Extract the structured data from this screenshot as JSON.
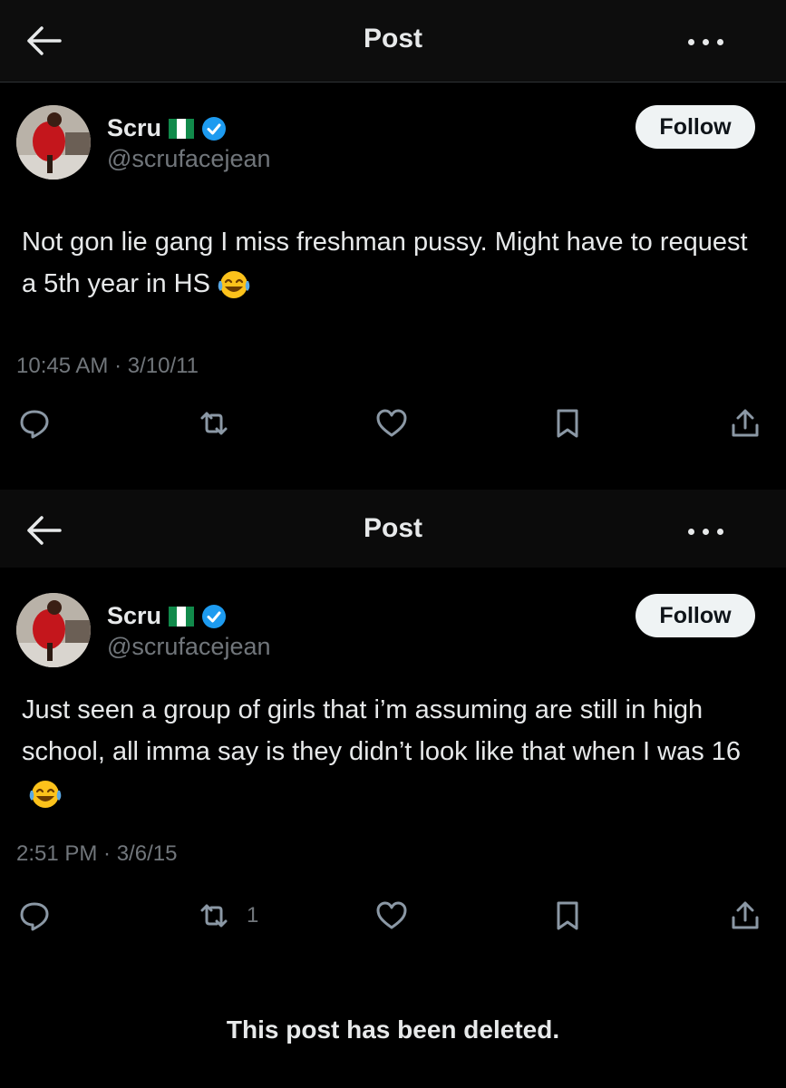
{
  "header": {
    "title": "Post"
  },
  "posts": [
    {
      "name": "Scru",
      "handle": "@scrufacejean",
      "follow_label": "Follow",
      "text": "Not gon lie gang I miss freshman pussy. Might have to request a 5th year in HS",
      "emoji": "face-with-tears-of-joy",
      "timestamp": "10:45 AM · 3/10/11",
      "retweet_count": ""
    },
    {
      "name": "Scru",
      "handle": "@scrufacejean",
      "follow_label": "Follow",
      "text": "Just seen a group of girls that i’m assuming are still in high school, all imma say is they didn’t look like that when I was 16",
      "emoji": "face-with-tears-of-joy",
      "timestamp": "2:51 PM · 3/6/15",
      "retweet_count": "1"
    }
  ],
  "footer": {
    "deleted_notice": "This post has been deleted."
  },
  "icons": [
    "back-arrow-icon",
    "more-icon",
    "verified-badge-icon",
    "nigeria-flag-icon",
    "reply-icon",
    "retweet-icon",
    "like-icon",
    "bookmark-icon",
    "share-icon"
  ],
  "colors": {
    "background": "#000000",
    "text": "#e7e9ea",
    "muted": "#71767b",
    "verified": "#1d9bf0",
    "follow_bg": "#eff3f4"
  }
}
